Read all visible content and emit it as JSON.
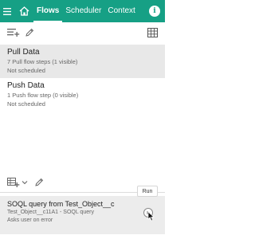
{
  "colors": {
    "accent": "#16a085",
    "selected_bg": "#e8e8e8",
    "step_bg": "#ececec"
  },
  "nav": {
    "menu_icon": "hamburger-icon",
    "home_icon": "home-icon",
    "tabs": [
      {
        "label": "Flows",
        "active": true
      },
      {
        "label": "Scheduler",
        "active": false
      },
      {
        "label": "Context",
        "active": false
      }
    ],
    "info_icon": "info-icon",
    "info_glyph": "i"
  },
  "toolbar": {
    "icons": [
      "add-flow-icon",
      "edit-pencil-icon",
      "table-grid-icon"
    ]
  },
  "flows": [
    {
      "title": "Pull Data",
      "subtitle": "7 Pull flow steps (1 visible)",
      "schedule": "Not scheduled",
      "selected": true
    },
    {
      "title": "Push Data",
      "subtitle": "1 Push flow step (0 visible)",
      "schedule": "Not scheduled",
      "selected": false
    }
  ],
  "bottom_toolbar": {
    "icons": [
      "add-step-icon",
      "chevron-down-icon",
      "edit-pencil-icon"
    ]
  },
  "step": {
    "title": "SOQL query from Test_Object__c",
    "subtitle": "Test_Object__c11A1 - SOQL query",
    "note": "Asks user on error"
  },
  "run_tooltip": "Run"
}
